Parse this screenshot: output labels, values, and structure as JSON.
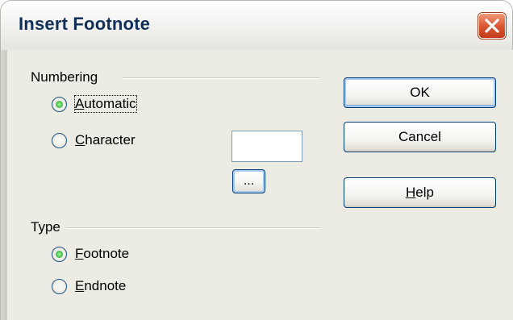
{
  "dialog": {
    "title": "Insert Footnote"
  },
  "numbering": {
    "group_label": "Numbering",
    "automatic": {
      "access": "A",
      "rest": "utomatic",
      "checked": true
    },
    "character": {
      "access": "C",
      "rest": "haracter",
      "checked": false
    },
    "character_value": "",
    "browse_label": "..."
  },
  "type": {
    "group_label": "Type",
    "footnote": {
      "access": "F",
      "rest": "ootnote",
      "checked": true
    },
    "endnote": {
      "access": "E",
      "rest": "ndnote",
      "checked": false
    }
  },
  "buttons": {
    "ok": "OK",
    "cancel": "Cancel",
    "help_access": "H",
    "help_rest": "elp"
  },
  "colors": {
    "title_text": "#10305a",
    "close_button": "#dc5a36",
    "dialog_bg": "#ecebe4"
  },
  "icons": {
    "close": "close-icon"
  }
}
